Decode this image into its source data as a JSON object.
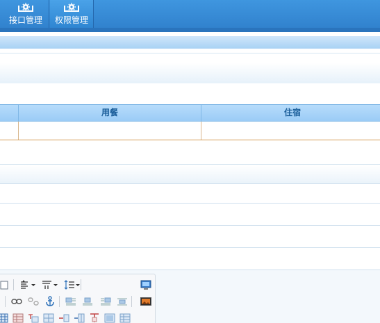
{
  "nav": {
    "items": [
      {
        "label": "接口管理",
        "icon": "gear-box-icon"
      },
      {
        "label": "权限管理",
        "icon": "gear-box-icon"
      }
    ]
  },
  "table": {
    "headers": [
      "用餐",
      "住宿"
    ],
    "rows": [
      [
        "",
        "",
        ""
      ]
    ]
  },
  "editor_toolbar": {
    "row1": [
      "font-size-icon",
      "paragraph-format-icon",
      "line-height-icon",
      "preview-icon"
    ],
    "row2": [
      "link-icon",
      "unlink-icon",
      "anchor-icon",
      "align-left-icon",
      "align-center-icon",
      "align-right-icon",
      "align-justify-icon",
      "image-icon"
    ],
    "row3": [
      "insert-table-icon",
      "delete-table-icon",
      "insert-row-icon",
      "delete-row-icon",
      "insert-col-icon",
      "delete-col-icon",
      "merge-cells-icon",
      "split-cells-icon",
      "table-props-icon"
    ]
  },
  "colors": {
    "topbar": "#3388d6",
    "header_row": "#a9d4f8",
    "header_text": "#1b5e9a",
    "row_border": "#d59b54"
  }
}
